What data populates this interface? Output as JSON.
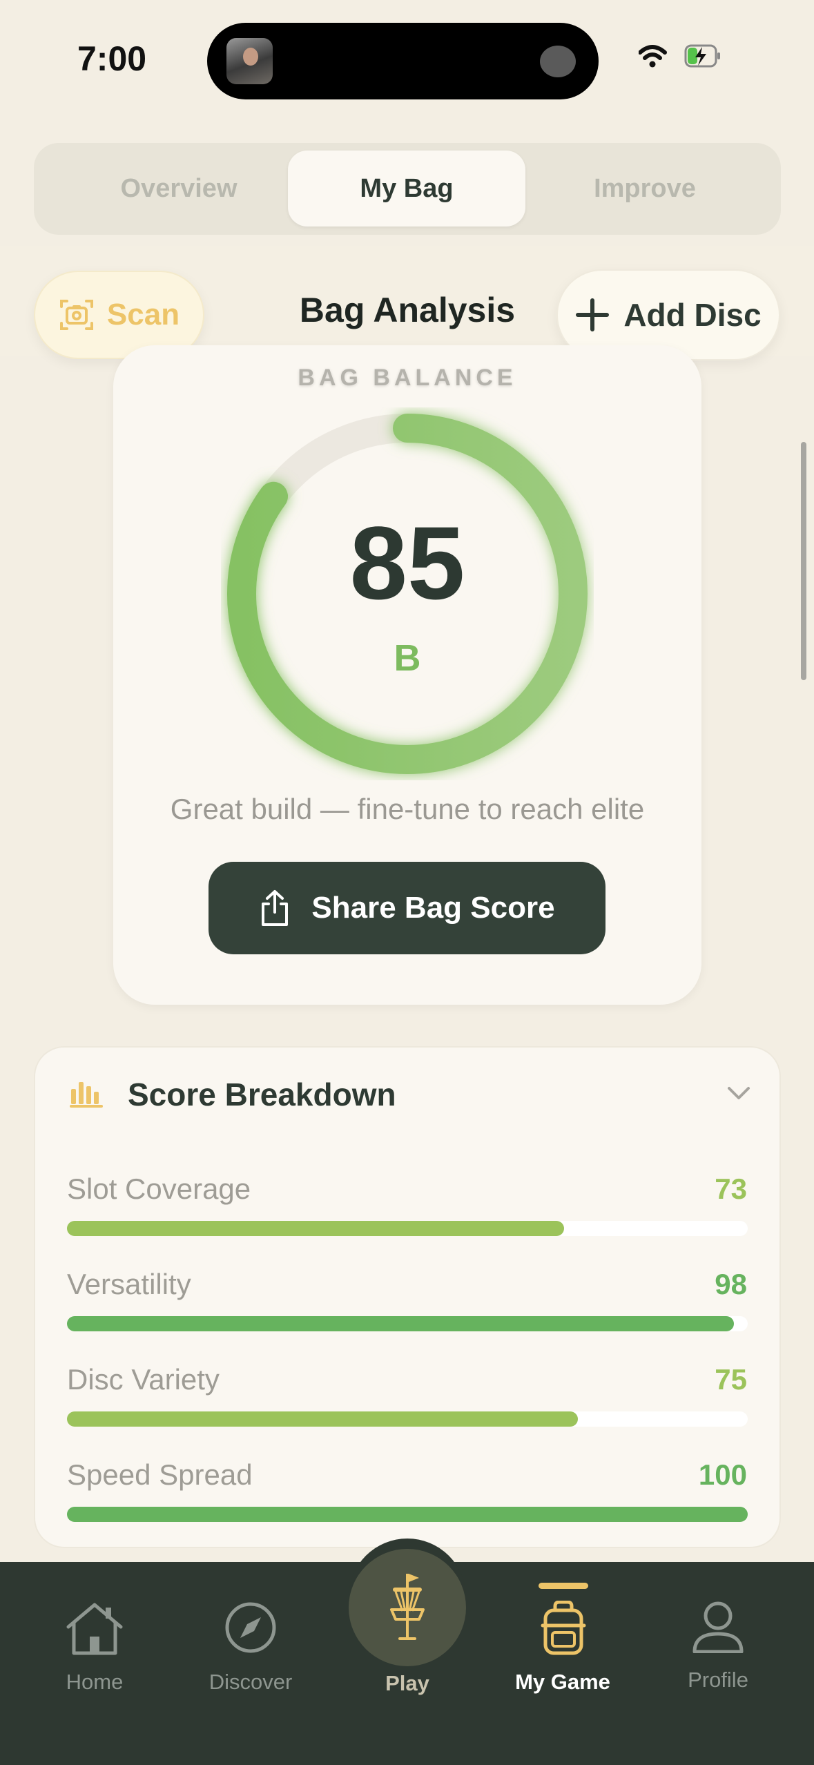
{
  "status_bar": {
    "time": "7:00"
  },
  "segments": [
    {
      "label": "Overview",
      "active": false
    },
    {
      "label": "My Bag",
      "active": true
    },
    {
      "label": "Improve",
      "active": false
    }
  ],
  "header": {
    "scan_label": "Scan",
    "title": "Bag Analysis",
    "add_label": "Add Disc"
  },
  "balance": {
    "label": "BAG BALANCE",
    "score": "85",
    "score_value": 85,
    "grade": "B",
    "message": "Great build — fine-tune to reach elite",
    "share_label": "Share Bag Score"
  },
  "breakdown": {
    "title": "Score Breakdown",
    "metrics": [
      {
        "label": "Slot Coverage",
        "value": "73",
        "percent": 73,
        "color": "#9BC35A"
      },
      {
        "label": "Versatility",
        "value": "98",
        "percent": 98,
        "color": "#66B35E"
      },
      {
        "label": "Disc Variety",
        "value": "75",
        "percent": 75,
        "color": "#9BC35A"
      },
      {
        "label": "Speed Spread",
        "value": "100",
        "percent": 100,
        "color": "#66B35E"
      }
    ]
  },
  "tabbar": {
    "items": [
      {
        "label": "Home",
        "icon": "home-icon"
      },
      {
        "label": "Discover",
        "icon": "compass-icon"
      },
      {
        "label": "Play",
        "icon": "disc-golf-basket-icon"
      },
      {
        "label": "My Game",
        "icon": "bag-icon",
        "active": true
      },
      {
        "label": "Profile",
        "icon": "person-icon"
      }
    ]
  },
  "colors": {
    "background": "#F3EEE3",
    "accent_gold": "#EDC468",
    "accent_green": "#7DBB5F",
    "dark": "#2E3831"
  }
}
